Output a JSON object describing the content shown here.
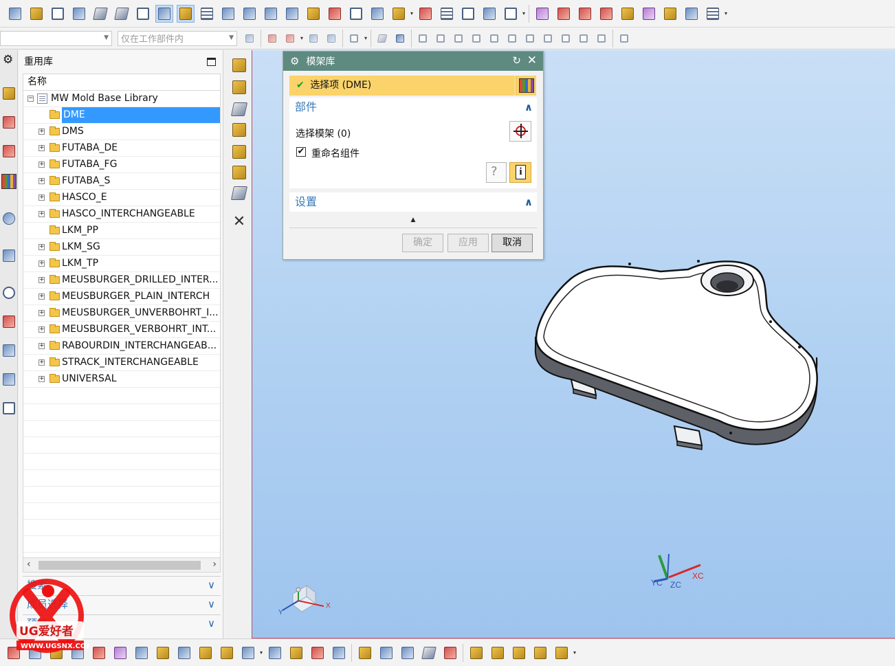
{
  "top_toolbar": {
    "row2": {
      "filter_select_value": "",
      "scope_select_value": "仅在工作部件内"
    }
  },
  "navigator": {
    "title": "重用库",
    "column_header": "名称",
    "root": "MW Mold Base Library",
    "items": [
      {
        "label": "DME",
        "expandable": false,
        "selected": true
      },
      {
        "label": "DMS",
        "expandable": true
      },
      {
        "label": "FUTABA_DE",
        "expandable": true
      },
      {
        "label": "FUTABA_FG",
        "expandable": true
      },
      {
        "label": "FUTABA_S",
        "expandable": true
      },
      {
        "label": "HASCO_E",
        "expandable": true
      },
      {
        "label": "HASCO_INTERCHANGEABLE",
        "expandable": true
      },
      {
        "label": "LKM_PP",
        "expandable": false
      },
      {
        "label": "LKM_SG",
        "expandable": true
      },
      {
        "label": "LKM_TP",
        "expandable": true
      },
      {
        "label": "MEUSBURGER_DRILLED_INTER...",
        "expandable": true
      },
      {
        "label": "MEUSBURGER_PLAIN_INTERCH",
        "expandable": true
      },
      {
        "label": "MEUSBURGER_UNVERBOHRT_I...",
        "expandable": true
      },
      {
        "label": "MEUSBURGER_VERBOHRT_INT...",
        "expandable": true
      },
      {
        "label": "RABOURDIN_INTERCHANGEAB...",
        "expandable": true
      },
      {
        "label": "STRACK_INTERCHANGEABLE",
        "expandable": true
      },
      {
        "label": "UNIVERSAL",
        "expandable": true
      }
    ],
    "sections": [
      {
        "label": "搜索"
      },
      {
        "label": "成员选择"
      },
      {
        "label": "预览"
      }
    ]
  },
  "dialog": {
    "title": "模架库",
    "selection_label": "选择项 (DME)",
    "group_parts": "部件",
    "select_mold_base": "选择模架 (0)",
    "rename_components": "重命名组件",
    "rename_checked": true,
    "group_settings": "设置",
    "buttons": {
      "ok": "确定",
      "apply": "应用",
      "cancel": "取消"
    }
  },
  "triad": {
    "xc": "XC",
    "yc": "YC",
    "zc": "ZC"
  },
  "wcs": {
    "x": "X",
    "y": "Y"
  },
  "watermark": {
    "brand": "UG爱好者",
    "url": "WWW.UGSNX.COM"
  },
  "colors": {
    "selection": "#3399ff",
    "dialog_title": "#5e8a80",
    "selection_bar": "#fbd36b",
    "group_heading": "#3a7ab8",
    "graphics_bg_top": "#c9dff6",
    "graphics_bg_bottom": "#9ec4ee"
  }
}
